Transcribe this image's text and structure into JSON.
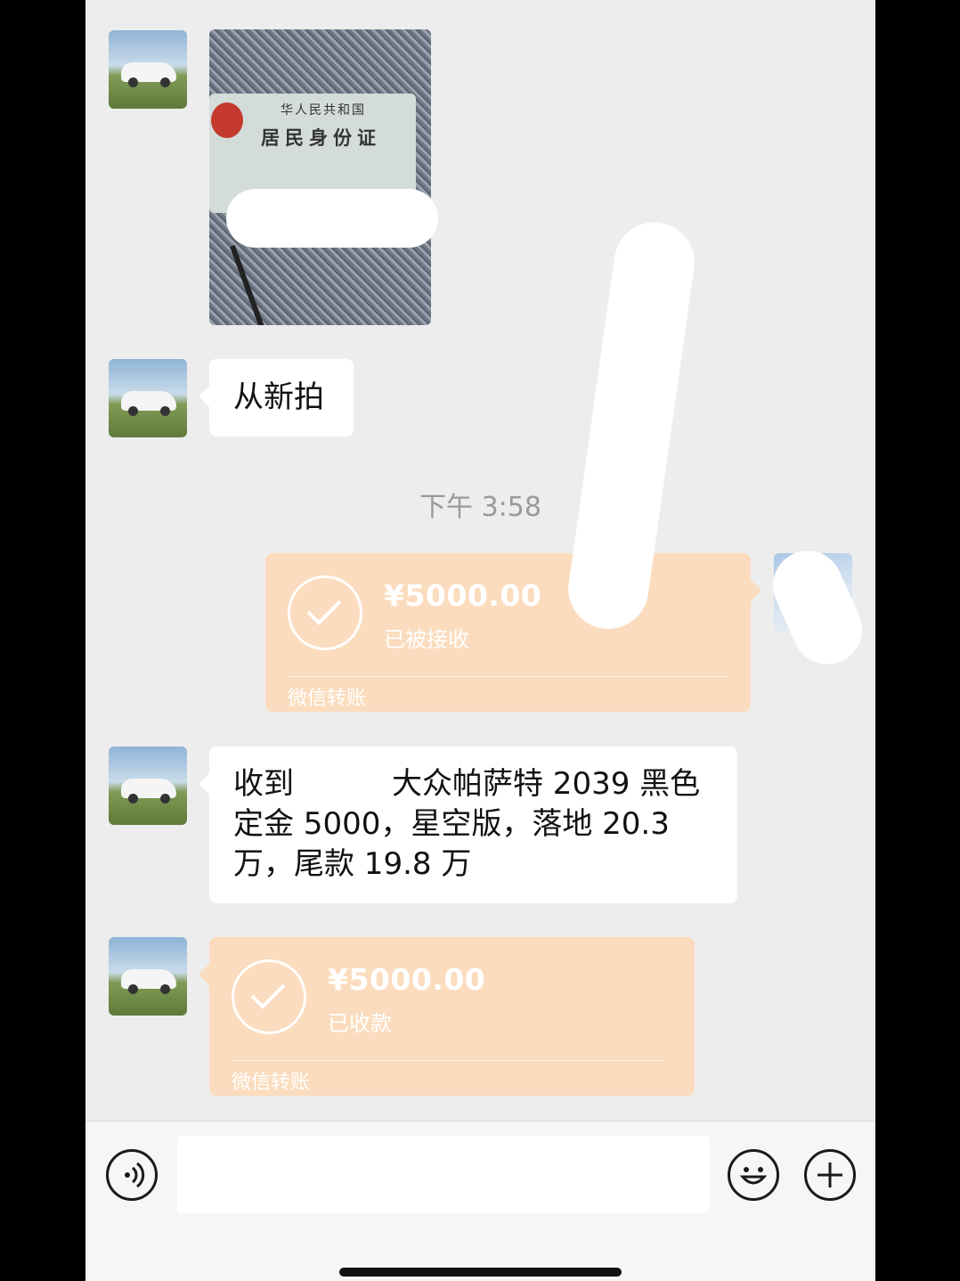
{
  "messages": {
    "photo": {
      "card_line1": "华人民共和国",
      "card_line2": "居民身份证"
    },
    "text1": "从新拍",
    "timestamp": "下午 3:58",
    "transfer_sent": {
      "amount": "¥5000.00",
      "status": "已被接收",
      "label": "微信转账"
    },
    "text2": {
      "line1_a": "收到",
      "line1_b": "大众帕萨特 2039 黑色",
      "line2": "定金 5000，星空版，落地 20.3",
      "line3": "万，尾款 19.8 万"
    },
    "transfer_received": {
      "amount": "¥5000.00",
      "status": "已收款",
      "label": "微信转账"
    }
  },
  "input_bar": {
    "input_value": ""
  }
}
